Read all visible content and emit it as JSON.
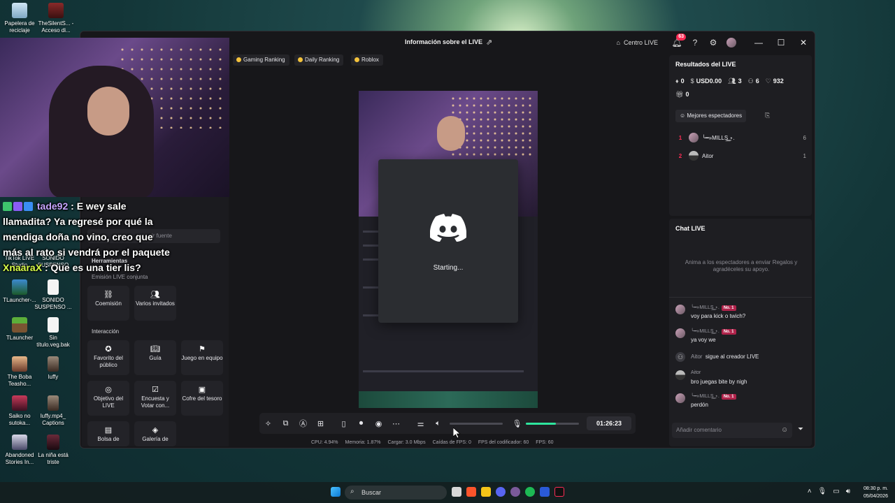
{
  "desktop": {
    "icons": [
      {
        "label": "Papelera de reciclaje"
      },
      {
        "label": "TheSilentS... - Acceso di..."
      },
      {
        "label": "TikTok LIVE Studio"
      },
      {
        "label": "SONIDO SUSPENSO"
      },
      {
        "label": "TLauncher-..."
      },
      {
        "label": "SONIDO SUSPENSO ..."
      },
      {
        "label": "TLauncher"
      },
      {
        "label": "Sin título.veg.bak"
      },
      {
        "label": "The Boba Teasho..."
      },
      {
        "label": "luffy"
      },
      {
        "label": "Saiko no sutoka..."
      },
      {
        "label": "luffy.mp4_ Captions"
      },
      {
        "label": "Abandoned Stories In..."
      },
      {
        "label": "La niña está triste"
      }
    ]
  },
  "overlay_chat": {
    "msg1_user": "tade92",
    "msg1_text": ": E wey sale llamadita? Ya regresé por qué la mendiga doña no vino, creo que más al rato si vendrá por el paquete",
    "msg2_user": "XnaaraX",
    "msg2_text": ": Que es una tier lis?"
  },
  "window": {
    "title": "Información sobre el LIVE",
    "centro_live": "Centro LIVE",
    "notif_count": "63"
  },
  "left_panel": {
    "add_source": "ir fuente",
    "herramientas": "Herramientas",
    "emision": "Emisión LIVE conjunta",
    "interaccion": "Interacción",
    "tools": [
      {
        "label": "Coemisión",
        "icon": "link-icon"
      },
      {
        "label": "Varios invitados",
        "icon": "users-icon"
      },
      {
        "label": "Favorito del público",
        "icon": "star-users-icon"
      },
      {
        "label": "Guía",
        "icon": "book-icon"
      },
      {
        "label": "Juego en equipo",
        "icon": "team-icon"
      },
      {
        "label": "Objetivo del LIVE",
        "icon": "target-icon"
      },
      {
        "label": "Encuesta y Votar con...",
        "icon": "poll-icon"
      },
      {
        "label": "Cofre del tesoro",
        "icon": "chest-icon"
      },
      {
        "label": "Bolsa de",
        "icon": "bag-icon"
      },
      {
        "label": "Galería de",
        "icon": "gallery-icon"
      }
    ]
  },
  "rankings": [
    {
      "label": "Gaming Ranking"
    },
    {
      "label": "Daily Ranking"
    },
    {
      "label": "Roblox"
    }
  ],
  "discord": {
    "status": "Starting..."
  },
  "controls": {
    "timer": "01:26:23",
    "volume_level": 0.0,
    "mic_level": 0.56
  },
  "stats": {
    "cpu": "CPU: 4.94%",
    "memoria": "Memoria: 1.87%",
    "cargar": "Cargar: 3.0 Mbps",
    "caidas": "Caídas de FPS: 0",
    "fps_cod": "FPS del codificador: 60",
    "fps": "FPS: 60"
  },
  "results": {
    "title": "Resultados del LIVE",
    "diamonds": "0",
    "usd": "USD0.00",
    "viewers": "3",
    "followers": "6",
    "likes": "932",
    "gifts": "0",
    "best_btn": "Mejores espectadores",
    "top_viewers": [
      {
        "rank": "1",
        "name": "╰━»MILLS͟͟͟ ⋆.",
        "count": "6"
      },
      {
        "rank": "2",
        "name": "Aitor",
        "count": "1"
      }
    ]
  },
  "chat": {
    "title": "Chat LIVE",
    "hint": "Anima a los espectadores a enviar Regalos y agradéceles su apoyo.",
    "badge": "No. 1",
    "messages": [
      {
        "user": "╰━»MILLS͟͟͟ ⋆.",
        "text": "voy para kick o twich?"
      },
      {
        "user": "╰━»MILLS͟͟͟ ⋆.",
        "text": "ya voy we"
      },
      {
        "user": "Aitor",
        "text": "sigue al creador LIVE"
      },
      {
        "user": "Aitor",
        "text": "bro juegas bite by nigh"
      },
      {
        "user": "╰━»MILLS͟͟͟ ⋆.",
        "text": "perdón"
      }
    ],
    "placeholder": "Añadir comentario"
  },
  "taskbar": {
    "search": "Buscar",
    "time": "08:30 p. m.",
    "date": "05/04/2026"
  },
  "colors": {
    "accent": "#fe2c55",
    "green": "#2ee59d",
    "gold": "#f3c23c"
  }
}
